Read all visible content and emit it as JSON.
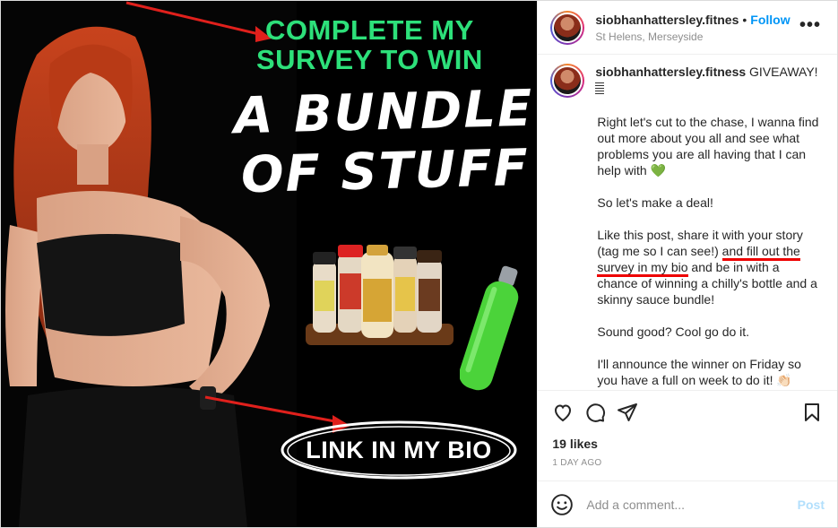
{
  "post": {
    "username": "siobhanhattersley.fitness",
    "location": "St Helens, Merseyside",
    "follow_label": "Follow",
    "dot": "•",
    "more_label": "•••"
  },
  "media": {
    "headline_line1": "COMPLETE MY",
    "headline_line2": "SURVEY TO WIN",
    "big_line1": "A BUNDLE",
    "big_line2": "OF STUFF",
    "badge_text": "LINK IN MY BIO",
    "accent_color": "#2de07a",
    "arrow_color": "#e0201c"
  },
  "caption": {
    "username": "siobhanhattersley.fitness",
    "first_line": "GIVEAWAY!",
    "para1": "Right let's cut to the chase, I wanna find out more about you all and see what problems you are all having that I can help with 💚",
    "para2": "So let's make a deal!",
    "para3_a": "Like this post, share it with your story (tag me so I can see!) ",
    "para3_b": "and fill out the",
    "para3_c": "survey in my bio",
    "para3_d": " and be in with a chance of winning a chilly's bottle and a skinny sauce bundle!",
    "para4": "Sound good? Cool go do it.",
    "para5": "I'll announce the winner on Friday so you have a full on week to do it! 👏🏻"
  },
  "stats": {
    "likes": "19 likes",
    "date": "1 DAY AGO"
  },
  "comment": {
    "placeholder": "Add a comment...",
    "post_label": "Post"
  }
}
